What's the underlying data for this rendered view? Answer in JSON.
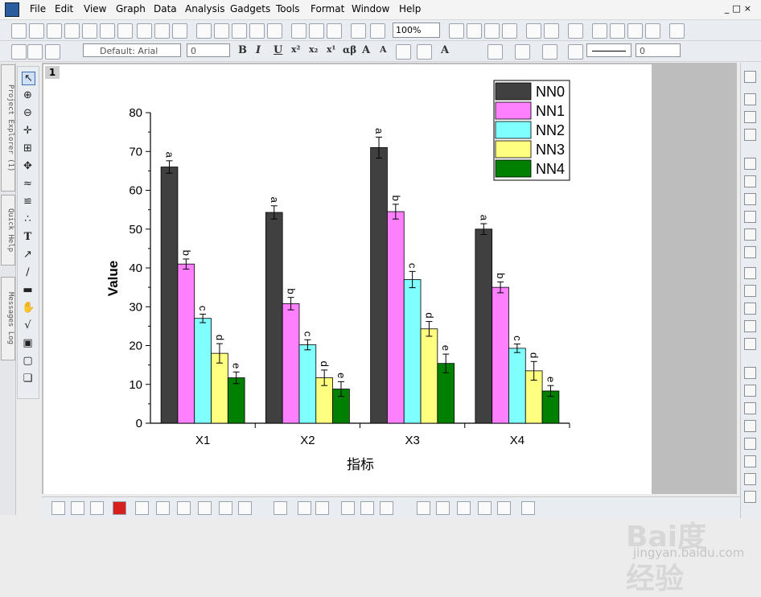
{
  "menu": [
    "File",
    "Edit",
    "View",
    "Graph",
    "Data",
    "Analysis",
    "Gadgets",
    "Tools",
    "Format",
    "Window",
    "Help"
  ],
  "toolbar": {
    "zoom": "100%",
    "font": "Default: Arial",
    "font_size": "0",
    "line_width": "0"
  },
  "side_tabs": [
    "Project Explorer (1)",
    "Quick Help",
    "Messages Log"
  ],
  "layer_tag": "1",
  "watermark": {
    "brand": "Bai度 经验",
    "url": "jingyan.baidu.com"
  },
  "chart_data": {
    "type": "bar",
    "title": "",
    "xlabel": "指标",
    "ylabel": "Value",
    "ylim": [
      0,
      80
    ],
    "yticks": [
      0,
      10,
      20,
      30,
      40,
      50,
      60,
      70,
      80
    ],
    "categories": [
      "X1",
      "X2",
      "X3",
      "X4"
    ],
    "legend_position": "top-right",
    "series": [
      {
        "name": "NN0",
        "color": "#404040",
        "values": [
          66,
          54.3,
          71,
          50
        ],
        "errors": [
          1.6,
          1.7,
          2.7,
          1.4
        ],
        "letters": [
          "a",
          "a",
          "a",
          "a"
        ]
      },
      {
        "name": "NN1",
        "color": "#ff80ff",
        "values": [
          41,
          30.8,
          54.5,
          35
        ],
        "errors": [
          1.3,
          1.6,
          1.9,
          1.4
        ],
        "letters": [
          "b",
          "b",
          "b",
          "b"
        ]
      },
      {
        "name": "NN2",
        "color": "#80ffff",
        "values": [
          27,
          20.2,
          37,
          19.3
        ],
        "errors": [
          1.1,
          1.3,
          2.1,
          1.1
        ],
        "letters": [
          "c",
          "c",
          "c",
          "c"
        ]
      },
      {
        "name": "NN3",
        "color": "#ffff80",
        "values": [
          18,
          11.7,
          24.3,
          13.5
        ],
        "errors": [
          2.5,
          2.0,
          1.9,
          2.4
        ],
        "letters": [
          "d",
          "d",
          "d",
          "d"
        ]
      },
      {
        "name": "NN4",
        "color": "#008000",
        "values": [
          11.7,
          8.8,
          15.4,
          8.3
        ],
        "errors": [
          1.5,
          1.9,
          2.4,
          1.4
        ],
        "letters": [
          "e",
          "e",
          "e",
          "e"
        ]
      }
    ]
  }
}
